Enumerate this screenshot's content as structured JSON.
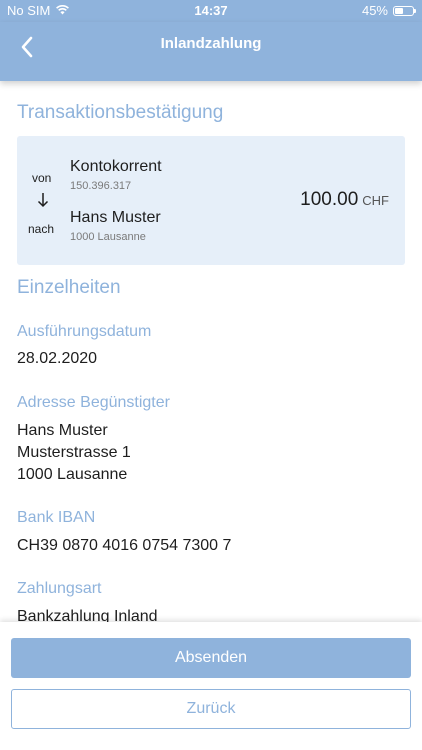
{
  "status_bar": {
    "carrier": "No SIM",
    "time": "14:37",
    "battery": "45%",
    "battery_level": 0.45,
    "wifi_icon": "wifi-icon"
  },
  "nav": {
    "title": "Inlandzahlung",
    "back_icon": "chevron-left-icon"
  },
  "confirmation": {
    "title": "Transaktionsbestätigung",
    "from_label": "von",
    "to_label": "nach",
    "from_account": "Kontokorrent",
    "from_number": "150.396.317",
    "to_name": "Hans Muster",
    "to_city": "1000 Lausanne",
    "amount": "100.00",
    "currency": "CHF"
  },
  "details": {
    "title": "Einzelheiten",
    "execution_date_label": "Ausführungsdatum",
    "execution_date": "28.02.2020",
    "address_label": "Adresse Begünstigter",
    "address_line1": "Hans Muster",
    "address_line2": "Musterstrasse 1",
    "address_line3": "1000 Lausanne",
    "iban_label": "Bank IBAN",
    "iban": "CH39 0870 4016 0754 7300 7",
    "payment_type_label": "Zahlungsart",
    "payment_type": "Bankzahlung Inland"
  },
  "actions": {
    "submit": "Absenden",
    "back": "Zurück"
  },
  "colors": {
    "accent": "#8fb3dc",
    "card_bg": "#e6eff9"
  }
}
